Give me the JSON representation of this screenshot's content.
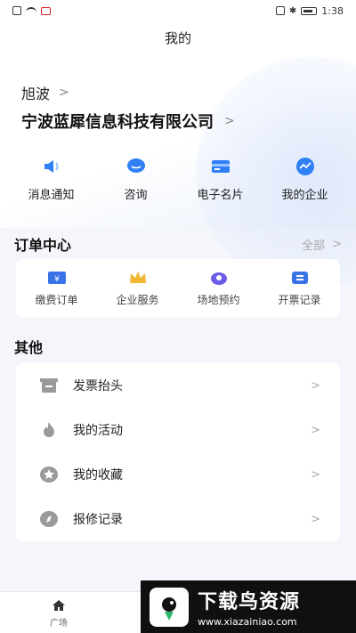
{
  "status_bar": {
    "time": "1:38"
  },
  "header": {
    "title": "我的"
  },
  "profile": {
    "name": "旭波",
    "chevron": ">",
    "company": "宁波蓝犀信息科技有限公司"
  },
  "quick_actions": [
    {
      "label": "消息通知",
      "icon": "speaker-icon"
    },
    {
      "label": "咨询",
      "icon": "chat-icon"
    },
    {
      "label": "电子名片",
      "icon": "card-icon"
    },
    {
      "label": "我的企业",
      "icon": "enterprise-icon"
    }
  ],
  "orders": {
    "title": "订单中心",
    "all_label": "全部",
    "items": [
      {
        "label": "缴费订单",
        "icon": "yen-icon"
      },
      {
        "label": "企业服务",
        "icon": "crown-icon"
      },
      {
        "label": "场地预约",
        "icon": "location-icon"
      },
      {
        "label": "开票记录",
        "icon": "receipt-icon"
      }
    ]
  },
  "other": {
    "title": "其他",
    "items": [
      {
        "label": "发票抬头",
        "icon": "invoice-icon"
      },
      {
        "label": "我的活动",
        "icon": "flame-icon"
      },
      {
        "label": "我的收藏",
        "icon": "star-icon"
      },
      {
        "label": "报修记录",
        "icon": "compass-icon"
      }
    ]
  },
  "tab_bar": {
    "home_label": "广场"
  },
  "watermark": {
    "title": "下载鸟资源",
    "url": "www.xiazainiao.com"
  },
  "colors": {
    "accent": "#2f7ff5",
    "gold": "#f2b733",
    "purple": "#6a5de8"
  }
}
